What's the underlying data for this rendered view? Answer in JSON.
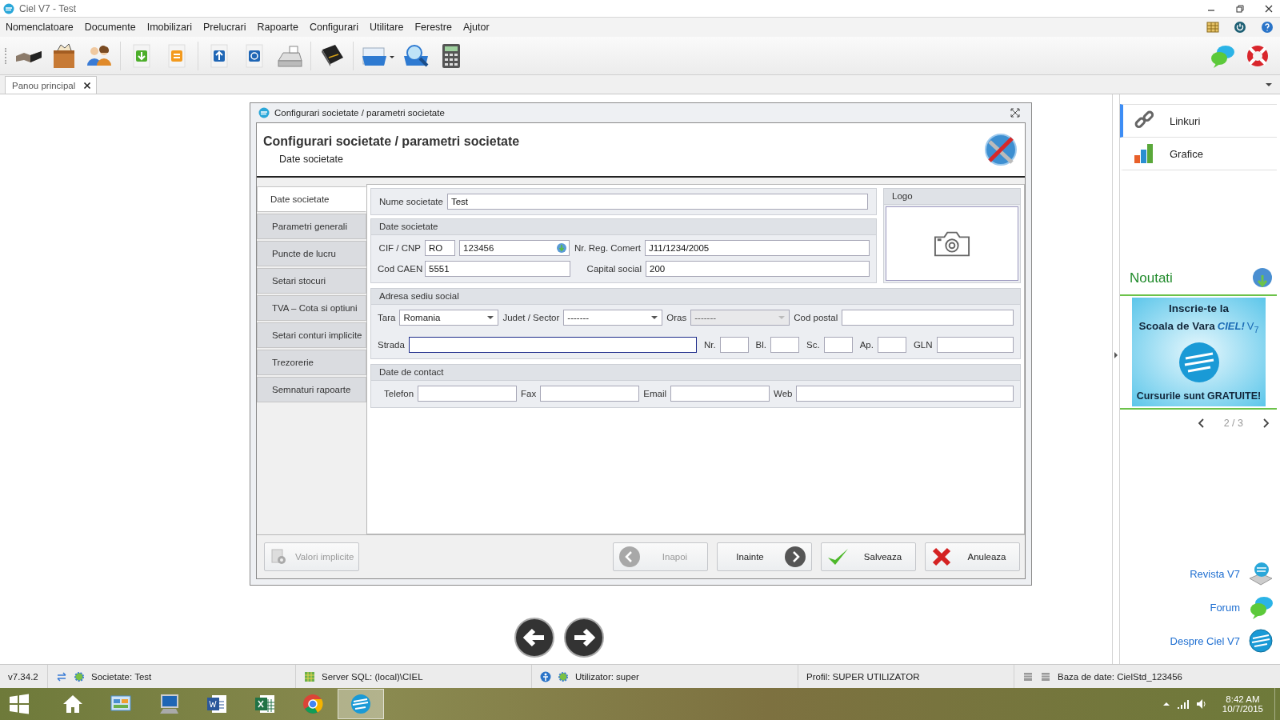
{
  "window": {
    "title": "Ciel V7 - Test"
  },
  "menu": [
    "Nomenclatoare",
    "Documente",
    "Imobilizari",
    "Prelucrari",
    "Rapoarte",
    "Configurari",
    "Utilitare",
    "Ferestre",
    "Ajutor"
  ],
  "tabs": [
    {
      "label": "Panou principal",
      "selected": true
    }
  ],
  "dialog": {
    "title": "Configurari societate / parametri societate",
    "heading": "Configurari societate / parametri societate",
    "subheading": "Date societate",
    "nav": [
      {
        "label": "Date societate",
        "selected": true
      },
      {
        "label": "Parametri generali",
        "selected": false
      },
      {
        "label": "Puncte de lucru",
        "selected": false
      },
      {
        "label": "Setari stocuri",
        "selected": false
      },
      {
        "label": "TVA – Cota si optiuni",
        "selected": false
      },
      {
        "label": "Setari conturi implicite",
        "selected": false
      },
      {
        "label": "Trezorerie",
        "selected": false
      },
      {
        "label": "Semnaturi rapoarte",
        "selected": false
      }
    ],
    "company_name": {
      "label": "Nume societate",
      "value": "Test"
    },
    "company": {
      "title": "Date societate",
      "cif_label": "CIF / CNP",
      "cif_prefix": "RO",
      "cif_value": "123456",
      "reg_label": "Nr. Reg. Comert",
      "reg_value": "J11/1234/2005",
      "caen_label": "Cod CAEN",
      "caen_value": "5551",
      "capital_label": "Capital social",
      "capital_value": "200"
    },
    "logo": {
      "title": "Logo"
    },
    "address": {
      "title": "Adresa sediu social",
      "country": {
        "label": "Tara",
        "value": "Romania",
        "disabled": false
      },
      "county": {
        "label": "Judet / Sector",
        "value": "-------",
        "disabled": false
      },
      "city": {
        "label": "Oras",
        "value": "-------",
        "disabled": true
      },
      "postal_label": "Cod postal",
      "street_label": "Strada",
      "street_focused": true,
      "small_fields": [
        "Nr.",
        "Bl.",
        "Sc.",
        "Ap."
      ],
      "gln_label": "GLN"
    },
    "contact": {
      "title": "Date de contact",
      "fields": [
        "Telefon",
        "Fax",
        "Email",
        "Web"
      ]
    },
    "buttons": [
      {
        "label": "Valori implicite",
        "kind": "defaults",
        "disabled": true
      },
      {
        "label": "Inapoi",
        "kind": "back",
        "disabled": true
      },
      {
        "label": "Inainte",
        "kind": "next",
        "disabled": false
      },
      {
        "label": "Salveaza",
        "kind": "save",
        "disabled": false
      },
      {
        "label": "Anuleaza",
        "kind": "cancel",
        "disabled": false
      }
    ]
  },
  "side_panel": {
    "items": [
      {
        "label": "Linkuri",
        "kind": "links",
        "selected": true
      },
      {
        "label": "Grafice",
        "kind": "charts",
        "selected": false
      }
    ],
    "news_title": "Noutati",
    "banner": {
      "line_1": "Inscrie-te la",
      "line_2": "Scoala de Vara",
      "logo": "CIEL!",
      "version": "V$_{7}$",
      "line_3": "Cursurile sunt GRATUITE!"
    },
    "pager": "2 / 3",
    "links": [
      {
        "label": "Revista V7",
        "kind": "magazine"
      },
      {
        "label": "Forum",
        "kind": "forum"
      },
      {
        "label": "Despre Ciel V7",
        "kind": "about"
      }
    ]
  },
  "status_bar": [
    {
      "kind": "version",
      "text": "v7.34.2"
    },
    {
      "kind": "company",
      "text": "Societate: Test"
    },
    {
      "kind": "server",
      "text": "Server SQL: (local)\\CIEL"
    },
    {
      "kind": "user",
      "text": "Utilizator: super"
    },
    {
      "kind": "profile",
      "text": "Profil: SUPER UTILIZATOR"
    },
    {
      "kind": "database",
      "text": "Baza de date: CielStd_123456"
    }
  ],
  "taskbar": {
    "apps": [
      {
        "kind": "home",
        "selected": false
      },
      {
        "kind": "control-panel",
        "selected": false
      },
      {
        "kind": "computer",
        "selected": false
      },
      {
        "kind": "document",
        "selected": false
      },
      {
        "kind": "spreadsheet",
        "selected": false
      },
      {
        "kind": "browser",
        "selected": false
      },
      {
        "kind": "ciel",
        "selected": true
      }
    ],
    "time": "8:42 AM",
    "date": "10/7/2015"
  }
}
